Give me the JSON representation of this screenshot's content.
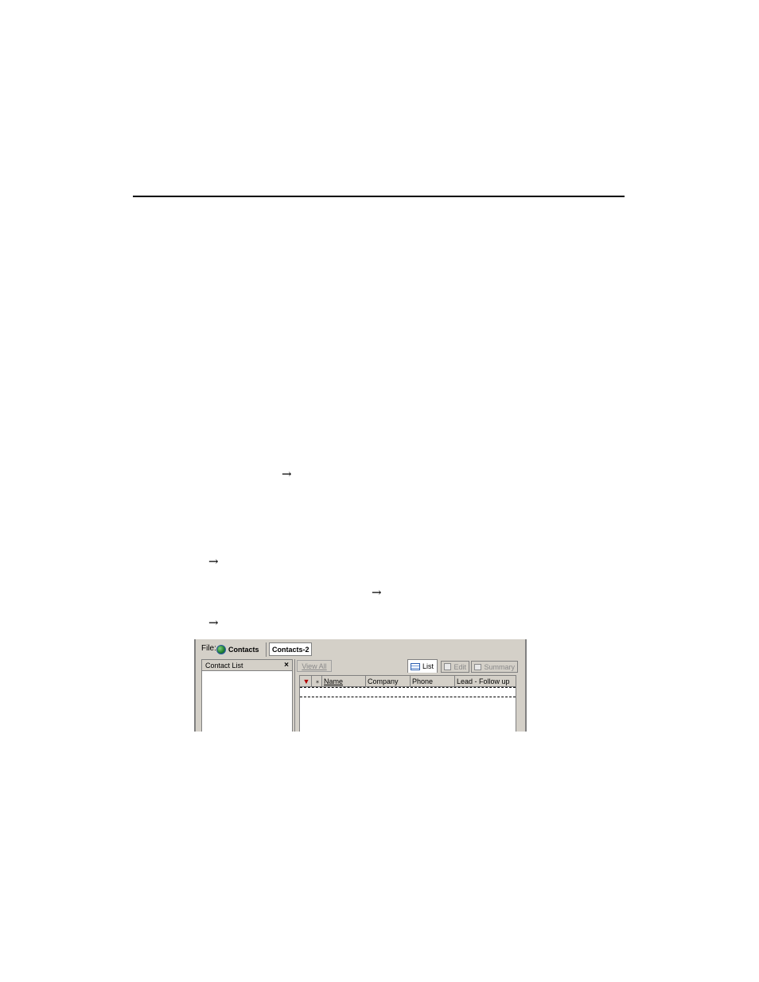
{
  "page": {
    "arrows": [
      "→",
      "→",
      "→",
      "→"
    ]
  },
  "screenshot": {
    "file_label": "File:",
    "tabs": [
      {
        "label": "Contacts",
        "icon": "globe-icon"
      },
      {
        "label": "Contacts-2"
      }
    ],
    "left_panel": {
      "title": "Contact List",
      "close_glyph": "×"
    },
    "toolbar": {
      "view_all_label": "View All"
    },
    "view_tabs": [
      {
        "label": "List",
        "icon": "list-view-icon",
        "active": true
      },
      {
        "label": "Edit",
        "icon": "edit-view-icon",
        "active": false
      },
      {
        "label": "Summary",
        "icon": "summary-view-icon",
        "active": false
      }
    ],
    "grid": {
      "columns": [
        "",
        "",
        "Name",
        "Company",
        "Phone",
        "Lead - Follow up"
      ],
      "flag_glyph": "▼",
      "pin_glyph": "⁎"
    }
  }
}
